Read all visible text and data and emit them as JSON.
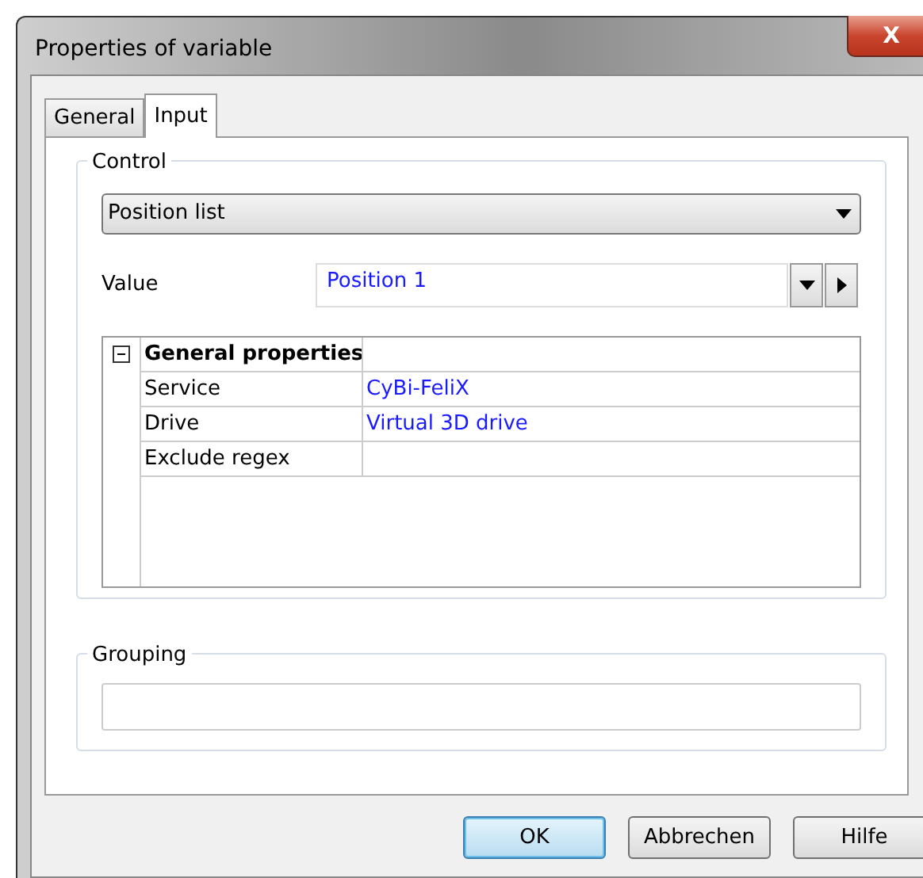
{
  "window": {
    "title": "Properties of variable",
    "close_glyph": "X"
  },
  "tabs": [
    {
      "label": "General",
      "selected": false
    },
    {
      "label": "Input",
      "selected": true
    }
  ],
  "control_group": {
    "legend": "Control",
    "dropdown": {
      "value": "Position list"
    },
    "value_label": "Value",
    "value_field": {
      "value": "Position 1"
    },
    "property_grid": {
      "category": {
        "label": "General properties",
        "expanded": true
      },
      "rows": [
        {
          "name": "Service",
          "value": "CyBi-FeliX"
        },
        {
          "name": "Drive",
          "value": "Virtual 3D drive"
        },
        {
          "name": "Exclude regex"
        }
      ]
    }
  },
  "grouping_group": {
    "legend": "Grouping"
  },
  "buttons": [
    {
      "label": "OK",
      "default": true
    },
    {
      "label": "Abbrechen",
      "default": false
    },
    {
      "label": "Hilfe",
      "default": false
    }
  ]
}
